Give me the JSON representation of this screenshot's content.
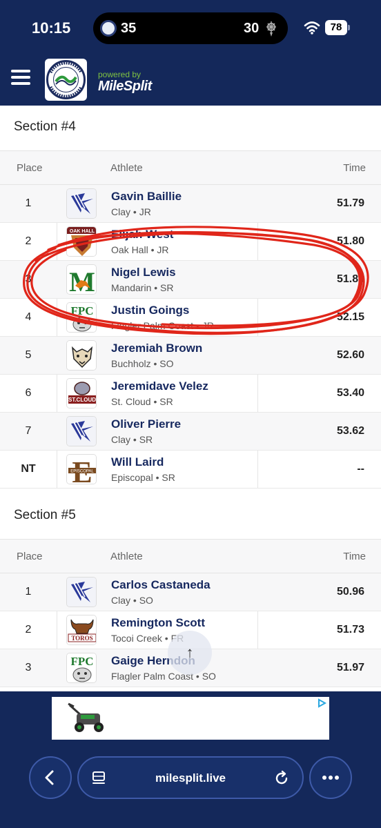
{
  "status_bar": {
    "time": "10:15",
    "score_left": "35",
    "score_right": "30",
    "battery": "78"
  },
  "header": {
    "logo_text": "JACKSONVILLE ATHLETIC CLUB",
    "powered_by": "powered by",
    "brand": "MileSplit"
  },
  "sections": [
    {
      "title": "Section #4",
      "columns": {
        "place": "Place",
        "athlete": "Athlete",
        "time": "Time"
      },
      "rows": [
        {
          "place": "1",
          "name": "Gavin Baillie",
          "meta": "Clay • JR",
          "time": "51.79",
          "logo": "clay"
        },
        {
          "place": "2",
          "name": "Elijah West",
          "meta": "Oak Hall • JR",
          "time": "51.80",
          "logo": "oakhall"
        },
        {
          "place": "3",
          "name": "Nigel Lewis",
          "meta": "Mandarin • SR",
          "time": "51.83",
          "logo": "mandarin"
        },
        {
          "place": "4",
          "name": "Justin Goings",
          "meta": "Flagler Palm Coast • JR",
          "time": "52.15",
          "logo": "fpc"
        },
        {
          "place": "5",
          "name": "Jeremiah Brown",
          "meta": "Buchholz • SO",
          "time": "52.60",
          "logo": "buchholz"
        },
        {
          "place": "6",
          "name": "Jeremidave Velez",
          "meta": "St. Cloud • SR",
          "time": "53.40",
          "logo": "stcloud"
        },
        {
          "place": "7",
          "name": "Oliver Pierre",
          "meta": "Clay • SR",
          "time": "53.62",
          "logo": "clay"
        },
        {
          "place": "NT",
          "name": "Will Laird",
          "meta": "Episcopal • SR",
          "time": "--",
          "logo": "episcopal"
        }
      ]
    },
    {
      "title": "Section #5",
      "columns": {
        "place": "Place",
        "athlete": "Athlete",
        "time": "Time"
      },
      "rows": [
        {
          "place": "1",
          "name": "Carlos Castaneda",
          "meta": "Clay • SO",
          "time": "50.96",
          "logo": "clay"
        },
        {
          "place": "2",
          "name": "Remington Scott",
          "meta": "Tocoi Creek • FR",
          "time": "51.73",
          "logo": "toros"
        },
        {
          "place": "3",
          "name": "Gaige Herndon",
          "meta": "Flagler Palm Coast • SO",
          "time": "51.97",
          "logo": "fpc"
        }
      ]
    }
  ],
  "logo_texts": {
    "oakhall": "OAK HALL",
    "mandarin": "M",
    "fpc": "FPC",
    "stcloud": "ST.CLOUD",
    "episcopal": "E",
    "episcopal_word": "EPISCOPAL",
    "toros": "TOROS"
  },
  "browser": {
    "url": "milesplit.live"
  },
  "colors": {
    "header_bg": "#14285a",
    "link_navy": "#16285f",
    "annotation_red": "#e0261a",
    "brand_green": "#7fc241"
  }
}
